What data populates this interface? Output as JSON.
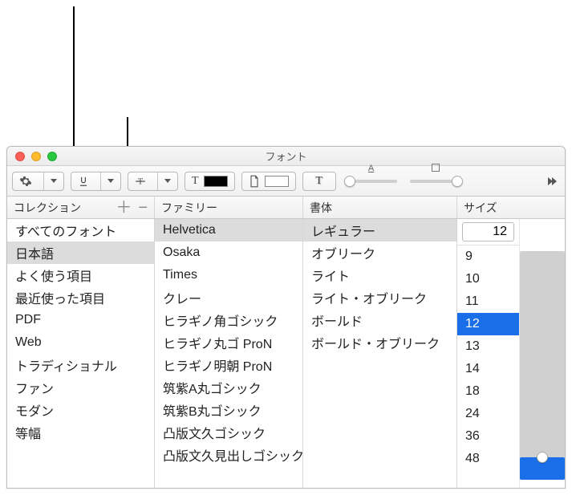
{
  "window": {
    "title": "フォント"
  },
  "columns": {
    "collection": "コレクション",
    "family": "ファミリー",
    "typeface": "書体",
    "size": "サイズ"
  },
  "collections": [
    {
      "label": "すべてのフォント",
      "selected": false
    },
    {
      "label": "日本語",
      "selected": true
    },
    {
      "label": "よく使う項目",
      "selected": false
    },
    {
      "label": "最近使った項目",
      "selected": false
    },
    {
      "label": "PDF",
      "selected": false
    },
    {
      "label": "Web",
      "selected": false
    },
    {
      "label": "トラディショナル",
      "selected": false
    },
    {
      "label": "ファン",
      "selected": false
    },
    {
      "label": "モダン",
      "selected": false
    },
    {
      "label": "等幅",
      "selected": false
    }
  ],
  "families": [
    {
      "label": "Helvetica",
      "selected": true
    },
    {
      "label": "Osaka",
      "selected": false
    },
    {
      "label": "Times",
      "selected": false
    },
    {
      "label": "クレー",
      "selected": false
    },
    {
      "label": "ヒラギノ角ゴシック",
      "selected": false
    },
    {
      "label": "ヒラギノ丸ゴ ProN",
      "selected": false
    },
    {
      "label": "ヒラギノ明朝 ProN",
      "selected": false
    },
    {
      "label": "筑紫A丸ゴシック",
      "selected": false
    },
    {
      "label": "筑紫B丸ゴシック",
      "selected": false
    },
    {
      "label": "凸版文久ゴシック",
      "selected": false
    },
    {
      "label": "凸版文久見出しゴシック",
      "selected": false
    }
  ],
  "typefaces": [
    {
      "label": "レギュラー",
      "selected": true
    },
    {
      "label": "オブリーク",
      "selected": false
    },
    {
      "label": "ライト",
      "selected": false
    },
    {
      "label": "ライト・オブリーク",
      "selected": false
    },
    {
      "label": "ボールド",
      "selected": false
    },
    {
      "label": "ボールド・オブリーク",
      "selected": false
    }
  ],
  "size": {
    "current": "12",
    "options": [
      "9",
      "10",
      "11",
      "12",
      "13",
      "14",
      "18",
      "24",
      "36",
      "48"
    ],
    "selected": "12",
    "slider_fill_pct": 10
  }
}
